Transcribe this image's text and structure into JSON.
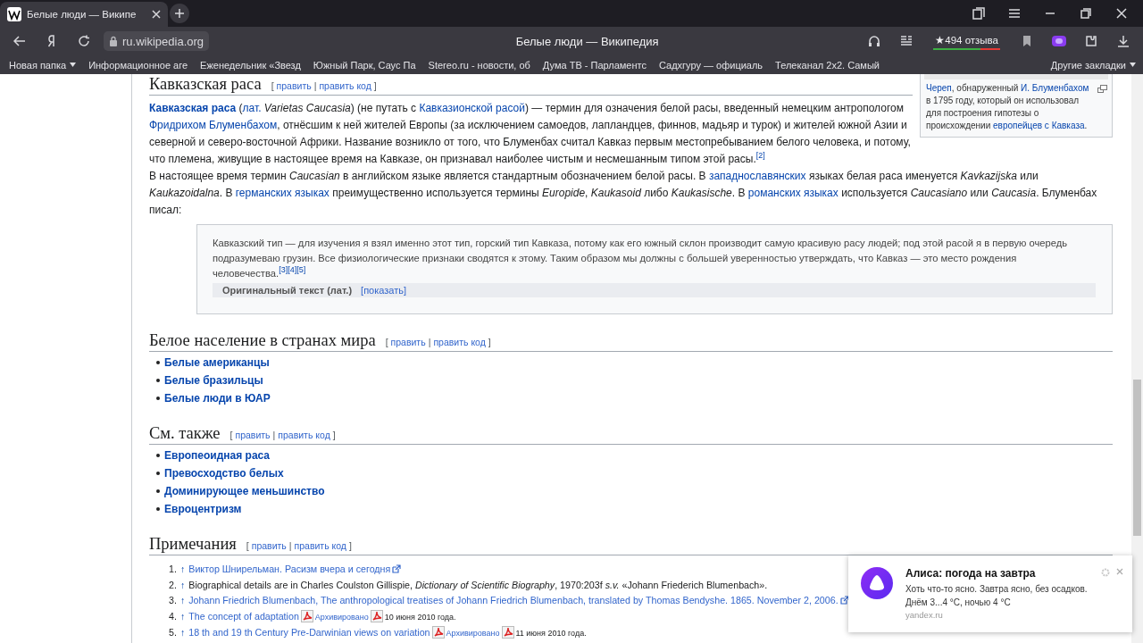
{
  "browser": {
    "tab": {
      "title": "Белые люди — Википе",
      "selected": true
    },
    "address": "ru.wikipedia.org",
    "page_title": "Белые люди — Википедия",
    "reviews": "★494 отзыва",
    "bookmarks": [
      {
        "label": "Новая папка",
        "folder": true
      },
      {
        "label": "Информационное аге",
        "folder": false
      },
      {
        "label": "Еженедельник «Звезд",
        "folder": false
      },
      {
        "label": "Южный Парк, Саус Па",
        "folder": false
      },
      {
        "label": "Stereo.ru - новости, об",
        "folder": false
      },
      {
        "label": "Дума ТВ - Парламентс",
        "folder": false
      },
      {
        "label": "Садхгуру — официаль",
        "folder": false
      },
      {
        "label": "Телеканал 2x2. Самый",
        "folder": false
      }
    ],
    "other_bookmarks": "Другие закладки"
  },
  "infobox": {
    "caption": [
      {
        "kind": "link",
        "text": "Череп"
      },
      {
        "kind": "text",
        "text": ", обнаруженный "
      },
      {
        "kind": "link",
        "text": "И. Блуменбахом"
      },
      {
        "kind": "text",
        "text": " в 1795 году, который он использовал для построения гипотезы о происхождении "
      },
      {
        "kind": "link",
        "text": "европейцев с Кавказа"
      },
      {
        "kind": "text",
        "text": "."
      }
    ]
  },
  "sections": [
    {
      "title": "Кавказская раса",
      "edit": {
        "open": "[",
        "links": [
          "править",
          "править код"
        ],
        "separator": "|",
        "close": "]"
      },
      "blocks": [
        {
          "kind": "paragraph",
          "parts": [
            {
              "kind": "bold-link",
              "text": "Кавказская раса"
            },
            {
              "kind": "text",
              "text": " ("
            },
            {
              "kind": "link",
              "text": "лат."
            },
            {
              "kind": "text",
              "text": " *Varietas Caucasia*) (не путать с "
            },
            {
              "kind": "link",
              "text": "Кавказионской расой"
            },
            {
              "kind": "text",
              "text": ") — термин для означения белой расы, введенный немецким антропологом "
            },
            {
              "kind": "link",
              "text": "Фридрихом Блуменбахом"
            },
            {
              "kind": "text",
              "text": ", отнёсшим к ней жителей Европы (за исключением самоедов, лапландцев, финнов, мадьяр и турок) и жителей южной Азии и северной и северо-восточной Африки. Название возникло от того, что Блуменбах считал Кавказ первым местопребыванием белого человека, и потому, что племена, живущие в настоящее время на Кавказе, он признавал наиболее чистым и несмешанным типом этой расы."
            },
            {
              "kind": "ref",
              "text": "[2]"
            }
          ]
        },
        {
          "kind": "paragraph",
          "parts": [
            {
              "kind": "text",
              "text": "В настоящее время термин *Caucasian* в английском языке является стандартным обозначением белой расы. В "
            },
            {
              "kind": "link",
              "text": "западнославянских"
            },
            {
              "kind": "text",
              "text": " языках белая раса именуется *Kavkazijska* или *Kaukazoidalna*. В "
            },
            {
              "kind": "link",
              "text": "германских языках"
            },
            {
              "kind": "text",
              "text": " преимущественно используется термины *Europide*, *Kaukasoid* либо *Kaukasische*. В "
            },
            {
              "kind": "link",
              "text": "романских языках"
            },
            {
              "kind": "text",
              "text": " используется *Caucasiano* или *Caucasia*. Блуменбах писал:"
            }
          ]
        },
        {
          "kind": "quote",
          "parts": [
            {
              "kind": "text",
              "text": "Кавказский тип — для изучения я взял именно этот тип, горский тип Кавказа, потому как его южный склон производит самую красивую расу людей; под этой расой я в первую очередь подразумеваю грузин. Все физиологические признаки сводятся к этому. Таким образом мы должны с большей уверенностью утверждать, что Кавказ — это место рождения человечества."
            },
            {
              "kind": "ref",
              "text": "[3]"
            },
            {
              "kind": "ref",
              "text": "[4]"
            },
            {
              "kind": "ref",
              "text": "[5]"
            }
          ],
          "original": {
            "label": "Оригинальный текст (лат.)",
            "toggle": "[показать]",
            "expanded": false
          }
        }
      ]
    },
    {
      "title": "Белое население в странах мира",
      "edit": {
        "open": "[",
        "links": [
          "править",
          "править код"
        ],
        "separator": "|",
        "close": "]"
      },
      "blocks": [
        {
          "kind": "list",
          "items": [
            "Белые американцы",
            "Белые бразильцы",
            "Белые люди в ЮАР"
          ]
        }
      ]
    },
    {
      "title": "См. также",
      "edit": {
        "open": "[",
        "links": [
          "править",
          "править код"
        ],
        "separator": "|",
        "close": "]"
      },
      "blocks": [
        {
          "kind": "list",
          "items": [
            "Европеоидная раса",
            "Превосходство белых",
            "Доминирующее меньшинство",
            "Евроцентризм"
          ]
        }
      ]
    },
    {
      "title": "Примечания",
      "edit": {
        "open": "[",
        "links": [
          "править",
          "править код"
        ],
        "separator": "|",
        "close": "]"
      },
      "blocks": [
        {
          "kind": "notes",
          "items": [
            {
              "number": "1.",
              "arrow": "↑",
              "parts": [
                {
                  "kind": "link",
                  "text": "Виктор Шнирельман. Расизм вчера и сегодня"
                },
                {
                  "kind": "external"
                }
              ]
            },
            {
              "number": "2.",
              "arrow": "↑",
              "parts": [
                {
                  "kind": "text",
                  "text": "Biographical details are in Charles Coulston Gillispie, *Dictionary of Scientific Biography*, 1970:203f *s.v.* «Johann Friederich Blumenbach»."
                }
              ]
            },
            {
              "number": "3.",
              "arrow": "↑",
              "parts": [
                {
                  "kind": "link",
                  "text": "Johann Friedrich Blumenbach, The anthropological treatises of Johann Friedrich Blumenbach, translated by Thomas Bendyshe. 1865. November 2, 2006."
                },
                {
                  "kind": "external"
                }
              ]
            },
            {
              "number": "4.",
              "arrow": "↑",
              "parts": [
                {
                  "kind": "link",
                  "text": "The concept of adaptation"
                },
                {
                  "kind": "pdf"
                },
                {
                  "kind": "small-link",
                  "text": "Архивировано"
                },
                {
                  "kind": "pdf"
                },
                {
                  "kind": "small",
                  "text": "10 июня 2010 года."
                }
              ]
            },
            {
              "number": "5.",
              "arrow": "↑",
              "parts": [
                {
                  "kind": "link",
                  "text": "18 th and 19 th Century Pre-Darwinian views on variation"
                },
                {
                  "kind": "pdf"
                },
                {
                  "kind": "small-link",
                  "text": "Архивировано"
                },
                {
                  "kind": "pdf"
                },
                {
                  "kind": "small",
                  "text": "11 июня 2010 года."
                }
              ]
            }
          ]
        }
      ]
    }
  ],
  "notification": {
    "title": "Алиса: погода на завтра",
    "lines": [
      "Хоть что-то ясно. Завтра ясно, без осадков.",
      "Днём 3...4 °C, ночью 4 °C"
    ],
    "source": "yandex.ru"
  }
}
